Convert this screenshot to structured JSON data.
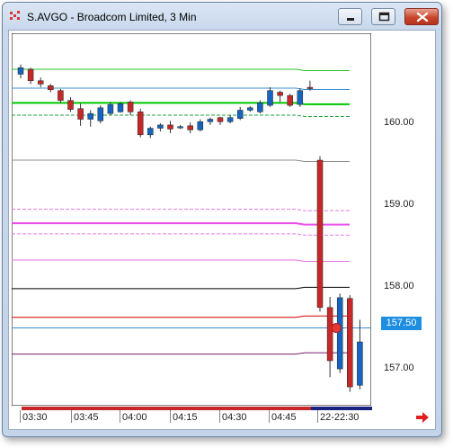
{
  "window": {
    "title": "S.AVGO - Broadcom Limited, 3 Min"
  },
  "icons": {
    "app": "chart-icon",
    "minimize": "minimize-icon",
    "maximize": "maximize-icon",
    "close": "close-icon",
    "scroll": "scroll-right-arrow-icon"
  },
  "colors": {
    "up": "#1565c0",
    "down": "#c62828",
    "price_tag": "#1e8ee0"
  },
  "chart_data": {
    "type": "candlestick",
    "symbol": "S.AVGO",
    "interval": "3 Min",
    "x_tick_labels": [
      "03:30",
      "03:45",
      "04:00",
      "04:15",
      "04:30",
      "04:45",
      "22-22:30"
    ],
    "y_tick_labels": [
      "160.00",
      "159.00",
      "158.00",
      "157.00"
    ],
    "ylim": [
      156.55,
      161.1
    ],
    "current_price": "157.50",
    "candles": [
      {
        "o": 160.6,
        "h": 160.72,
        "l": 160.55,
        "c": 160.68
      },
      {
        "o": 160.66,
        "h": 160.68,
        "l": 160.48,
        "c": 160.52
      },
      {
        "o": 160.52,
        "h": 160.56,
        "l": 160.44,
        "c": 160.48
      },
      {
        "o": 160.46,
        "h": 160.48,
        "l": 160.38,
        "c": 160.41
      },
      {
        "o": 160.4,
        "h": 160.42,
        "l": 160.25,
        "c": 160.28
      },
      {
        "o": 160.28,
        "h": 160.32,
        "l": 160.14,
        "c": 160.17
      },
      {
        "o": 160.18,
        "h": 160.24,
        "l": 159.97,
        "c": 160.05
      },
      {
        "o": 160.05,
        "h": 160.16,
        "l": 159.96,
        "c": 160.12
      },
      {
        "o": 160.03,
        "h": 160.22,
        "l": 160.0,
        "c": 160.19
      },
      {
        "o": 160.12,
        "h": 160.26,
        "l": 160.1,
        "c": 160.23
      },
      {
        "o": 160.14,
        "h": 160.26,
        "l": 160.13,
        "c": 160.24
      },
      {
        "o": 160.26,
        "h": 160.28,
        "l": 160.1,
        "c": 160.14
      },
      {
        "o": 160.14,
        "h": 160.18,
        "l": 159.83,
        "c": 159.86
      },
      {
        "o": 159.86,
        "h": 159.96,
        "l": 159.82,
        "c": 159.94
      },
      {
        "o": 159.94,
        "h": 160.0,
        "l": 159.9,
        "c": 159.98
      },
      {
        "o": 159.98,
        "h": 160.03,
        "l": 159.88,
        "c": 159.93
      },
      {
        "o": 159.95,
        "h": 159.98,
        "l": 159.93,
        "c": 159.96
      },
      {
        "o": 159.97,
        "h": 160.01,
        "l": 159.88,
        "c": 159.92
      },
      {
        "o": 159.92,
        "h": 160.05,
        "l": 159.9,
        "c": 160.02
      },
      {
        "o": 160.02,
        "h": 160.07,
        "l": 159.98,
        "c": 160.05
      },
      {
        "o": 160.07,
        "h": 160.08,
        "l": 159.98,
        "c": 160.02
      },
      {
        "o": 160.02,
        "h": 160.1,
        "l": 160.0,
        "c": 160.07
      },
      {
        "o": 160.06,
        "h": 160.2,
        "l": 160.04,
        "c": 160.16
      },
      {
        "o": 160.16,
        "h": 160.21,
        "l": 160.14,
        "c": 160.19
      },
      {
        "o": 160.14,
        "h": 160.28,
        "l": 160.12,
        "c": 160.25
      },
      {
        "o": 160.22,
        "h": 160.44,
        "l": 160.2,
        "c": 160.4
      },
      {
        "o": 160.38,
        "h": 160.4,
        "l": 160.26,
        "c": 160.34
      },
      {
        "o": 160.34,
        "h": 160.36,
        "l": 160.2,
        "c": 160.22
      },
      {
        "o": 160.23,
        "h": 160.43,
        "l": 160.2,
        "c": 160.4
      },
      {
        "o": 160.44,
        "h": 160.52,
        "l": 160.4,
        "c": 160.43
      },
      {
        "o": 159.55,
        "h": 159.6,
        "l": 157.7,
        "c": 157.75
      },
      {
        "o": 157.75,
        "h": 157.88,
        "l": 156.9,
        "c": 157.1
      },
      {
        "o": 157.0,
        "h": 157.92,
        "l": 156.95,
        "c": 157.87
      },
      {
        "o": 157.86,
        "h": 157.9,
        "l": 156.72,
        "c": 156.78
      },
      {
        "o": 156.8,
        "h": 157.6,
        "l": 156.75,
        "c": 157.33
      }
    ],
    "reference_lines": [
      {
        "price": 160.66,
        "color": "#26c226",
        "style": "solid",
        "width": 1
      },
      {
        "price": 160.43,
        "color": "#3a8fd0",
        "style": "solid",
        "width": 1
      },
      {
        "price": 160.25,
        "color": "#00c800",
        "style": "solid",
        "width": 2
      },
      {
        "price": 160.1,
        "color": "#20a040",
        "style": "dashed",
        "width": 1
      },
      {
        "price": 159.55,
        "color": "#8c8c8c",
        "style": "solid",
        "width": 1
      },
      {
        "price": 158.95,
        "color": "#e07ae0",
        "style": "dashed",
        "width": 1
      },
      {
        "price": 158.78,
        "color": "#e94ee9",
        "style": "solid",
        "width": 2
      },
      {
        "price": 158.65,
        "color": "#e07ae0",
        "style": "dashed",
        "width": 1
      },
      {
        "price": 158.33,
        "color": "#e36fe3",
        "style": "solid",
        "width": 1
      },
      {
        "price": 157.98,
        "color": "#000000",
        "style": "solid",
        "width": 1
      },
      {
        "price": 157.63,
        "color": "#d40000",
        "style": "solid",
        "width": 1
      },
      {
        "price": 157.5,
        "color": "#3a8fd0",
        "style": "solid",
        "width": 1
      },
      {
        "price": 157.18,
        "color": "#7a1f6f",
        "style": "solid",
        "width": 1
      }
    ]
  }
}
